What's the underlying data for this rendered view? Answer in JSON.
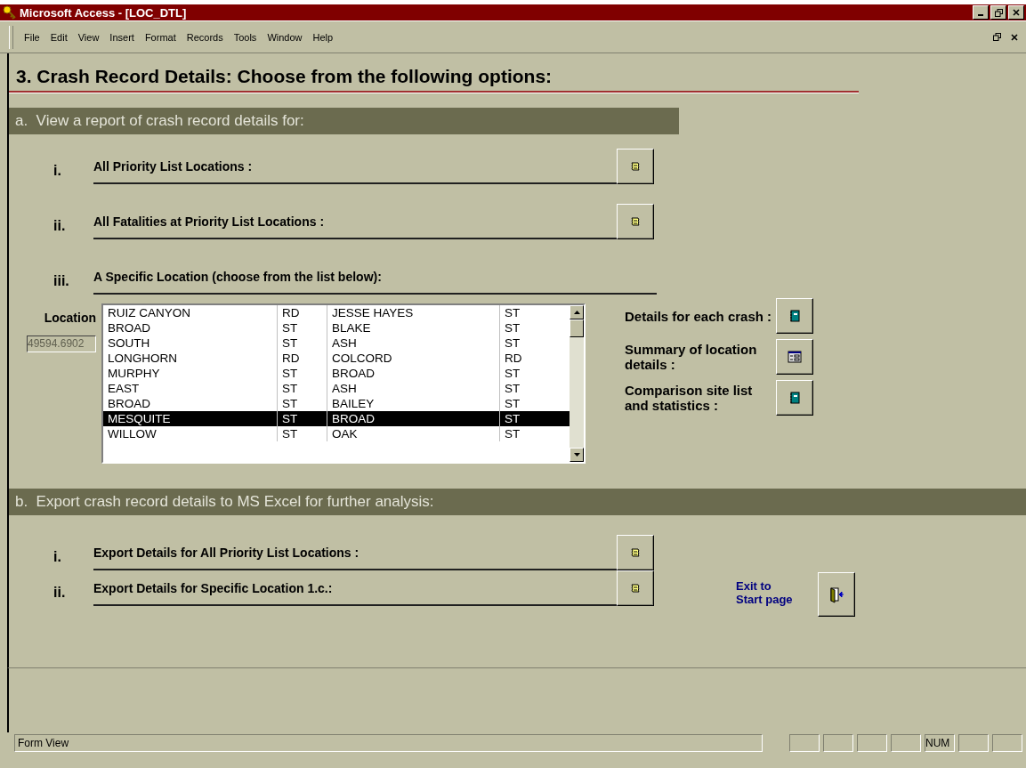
{
  "window": {
    "title": "Microsoft Access - [LOC_DTL]"
  },
  "menu": [
    "File",
    "Edit",
    "View",
    "Insert",
    "Format",
    "Records",
    "Tools",
    "Window",
    "Help"
  ],
  "form_title": "3. Crash Record Details: Choose from the following options:",
  "section_a": {
    "heading": "a.  View a report of crash record details for:",
    "rows": [
      {
        "numeral": "i.",
        "label": "All Priority List Locations :"
      },
      {
        "numeral": "ii.",
        "label": "All Fatalities at Priority List Locations :"
      }
    ],
    "specific": {
      "numeral": "iii.",
      "label": "A Specific Location (choose from the list below):"
    },
    "location_label": "Location",
    "location_value": "49594.6902",
    "list_rows": [
      {
        "cells": [
          "RUIZ CANYON",
          "RD",
          "JESSE HAYES",
          "ST"
        ],
        "selected": false
      },
      {
        "cells": [
          "BROAD",
          "ST",
          "BLAKE",
          "ST"
        ],
        "selected": false
      },
      {
        "cells": [
          "SOUTH",
          "ST",
          "ASH",
          "ST"
        ],
        "selected": false
      },
      {
        "cells": [
          "LONGHORN",
          "RD",
          "COLCORD",
          "RD"
        ],
        "selected": false
      },
      {
        "cells": [
          "MURPHY",
          "ST",
          "BROAD",
          "ST"
        ],
        "selected": false
      },
      {
        "cells": [
          "EAST",
          "ST",
          "ASH",
          "ST"
        ],
        "selected": false
      },
      {
        "cells": [
          "BROAD",
          "ST",
          "BAILEY",
          "ST"
        ],
        "selected": false
      },
      {
        "cells": [
          "MESQUITE",
          "ST",
          "BROAD",
          "ST"
        ],
        "selected": true
      },
      {
        "cells": [
          "WILLOW",
          "ST",
          "OAK",
          "ST"
        ],
        "selected": false
      }
    ],
    "reports": [
      {
        "label": "Details for each crash :",
        "kind": "book"
      },
      {
        "label": "Summary of location details :",
        "kind": "form"
      },
      {
        "label": "Comparison site list and statistics :",
        "kind": "book"
      }
    ]
  },
  "section_b": {
    "heading": "b.  Export crash record details to MS Excel for further analysis:",
    "rows": [
      {
        "numeral": "i.",
        "label": "Export Details for All Priority List Locations :"
      },
      {
        "numeral": "ii.",
        "label": "Export Details for Specific Location 1.c.:"
      }
    ],
    "exit_label": "Exit to Start page"
  },
  "status_bar": {
    "text": "Form View",
    "indicators": [
      {
        "text": "NUM"
      }
    ]
  }
}
